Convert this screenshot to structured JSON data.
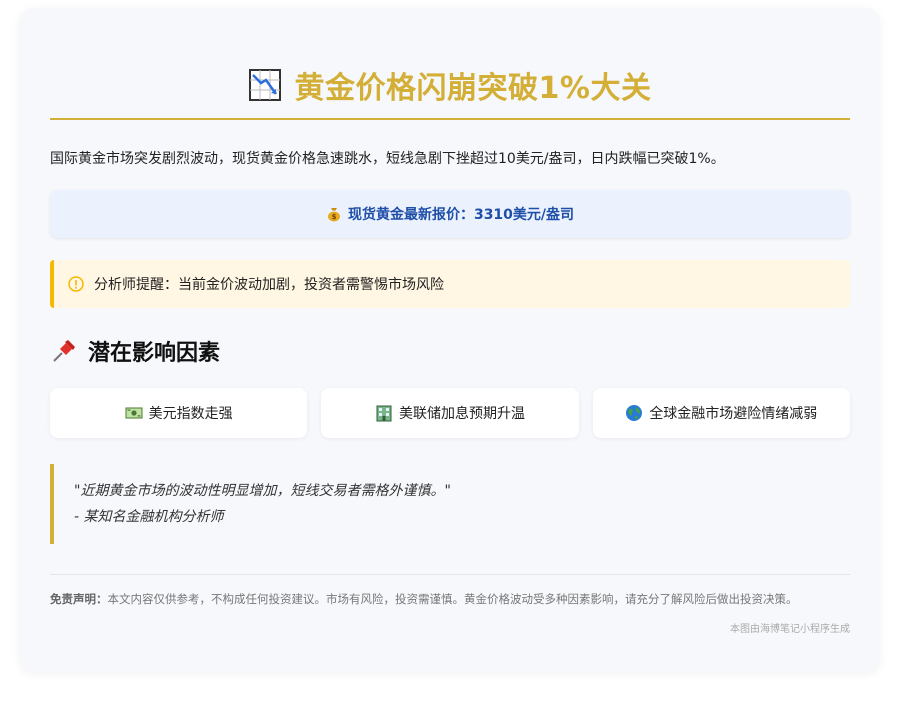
{
  "title": {
    "icon": "chart-decreasing-icon",
    "text": "黄金价格闪崩突破1%大关"
  },
  "intro": "国际黄金市场突发剧烈波动，现货黄金价格急速跳水，短线急剧下挫超过10美元/盎司，日内跌幅已突破1%。",
  "price": {
    "icon": "money-bag-icon",
    "text": "现货黄金最新报价：3310美元/盎司"
  },
  "warning": {
    "icon": "warning-circle-icon",
    "text": "分析师提醒：当前金价波动加剧，投资者需警惕市场风险"
  },
  "section": {
    "icon": "pushpin-icon",
    "title": "潜在影响因素"
  },
  "factors": [
    {
      "icon": "dollar-banknote-icon",
      "label": "美元指数走强"
    },
    {
      "icon": "bank-building-icon",
      "label": "美联储加息预期升温"
    },
    {
      "icon": "globe-icon",
      "label": "全球金融市场避险情绪减弱"
    }
  ],
  "quote": {
    "text": "\"近期黄金市场的波动性明显增加，短线交易者需格外谨慎。\"",
    "source": "- 某知名金融机构分析师"
  },
  "disclaimer": {
    "label": "免责声明：",
    "text": "本文内容仅供参考，不构成任何投资建议。市场有风险，投资需谨慎。黄金价格波动受多种因素影响，请充分了解风险后做出投资决策。"
  },
  "footer": "本图由海博笔记小程序生成",
  "colors": {
    "accent_gold": "#d4af37",
    "price_blue": "#1f4fa8",
    "warning_yellow": "#f5b800"
  }
}
